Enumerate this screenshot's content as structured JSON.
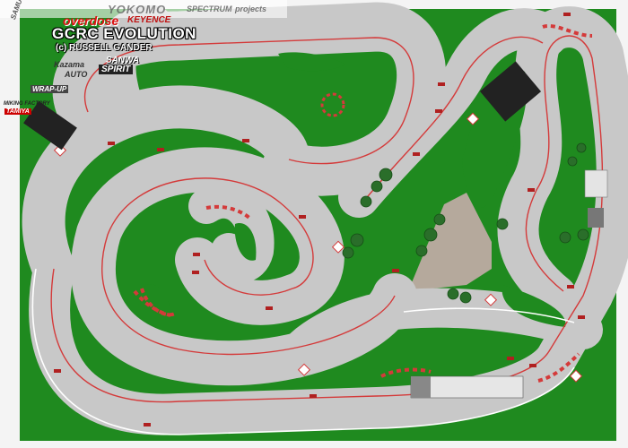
{
  "header": {
    "title": "GCRC EVOLUTION",
    "credit": "(c) RUSSELL GANDER"
  },
  "sponsors": {
    "overdose": "overdose",
    "keyence": "KEYENCE",
    "yokomo": "YOKOMO",
    "spec": "SPECTRUM",
    "proj": "projects",
    "sanwa": "SANWA",
    "kazama": "Kazama",
    "auto": "AUTO",
    "spirit": "SPIRIT",
    "samurai": "SAMURAI",
    "mf": "MIKING FACTORY",
    "tamiya": "TAMIYA",
    "wrap": "WRAP-UP"
  },
  "colors": {
    "grass": "#1f8a1f",
    "track": "#c8c8c8",
    "racing_line": "#d43a3a",
    "gravel": "#b5a99c",
    "bg": "#f4f4f4"
  }
}
